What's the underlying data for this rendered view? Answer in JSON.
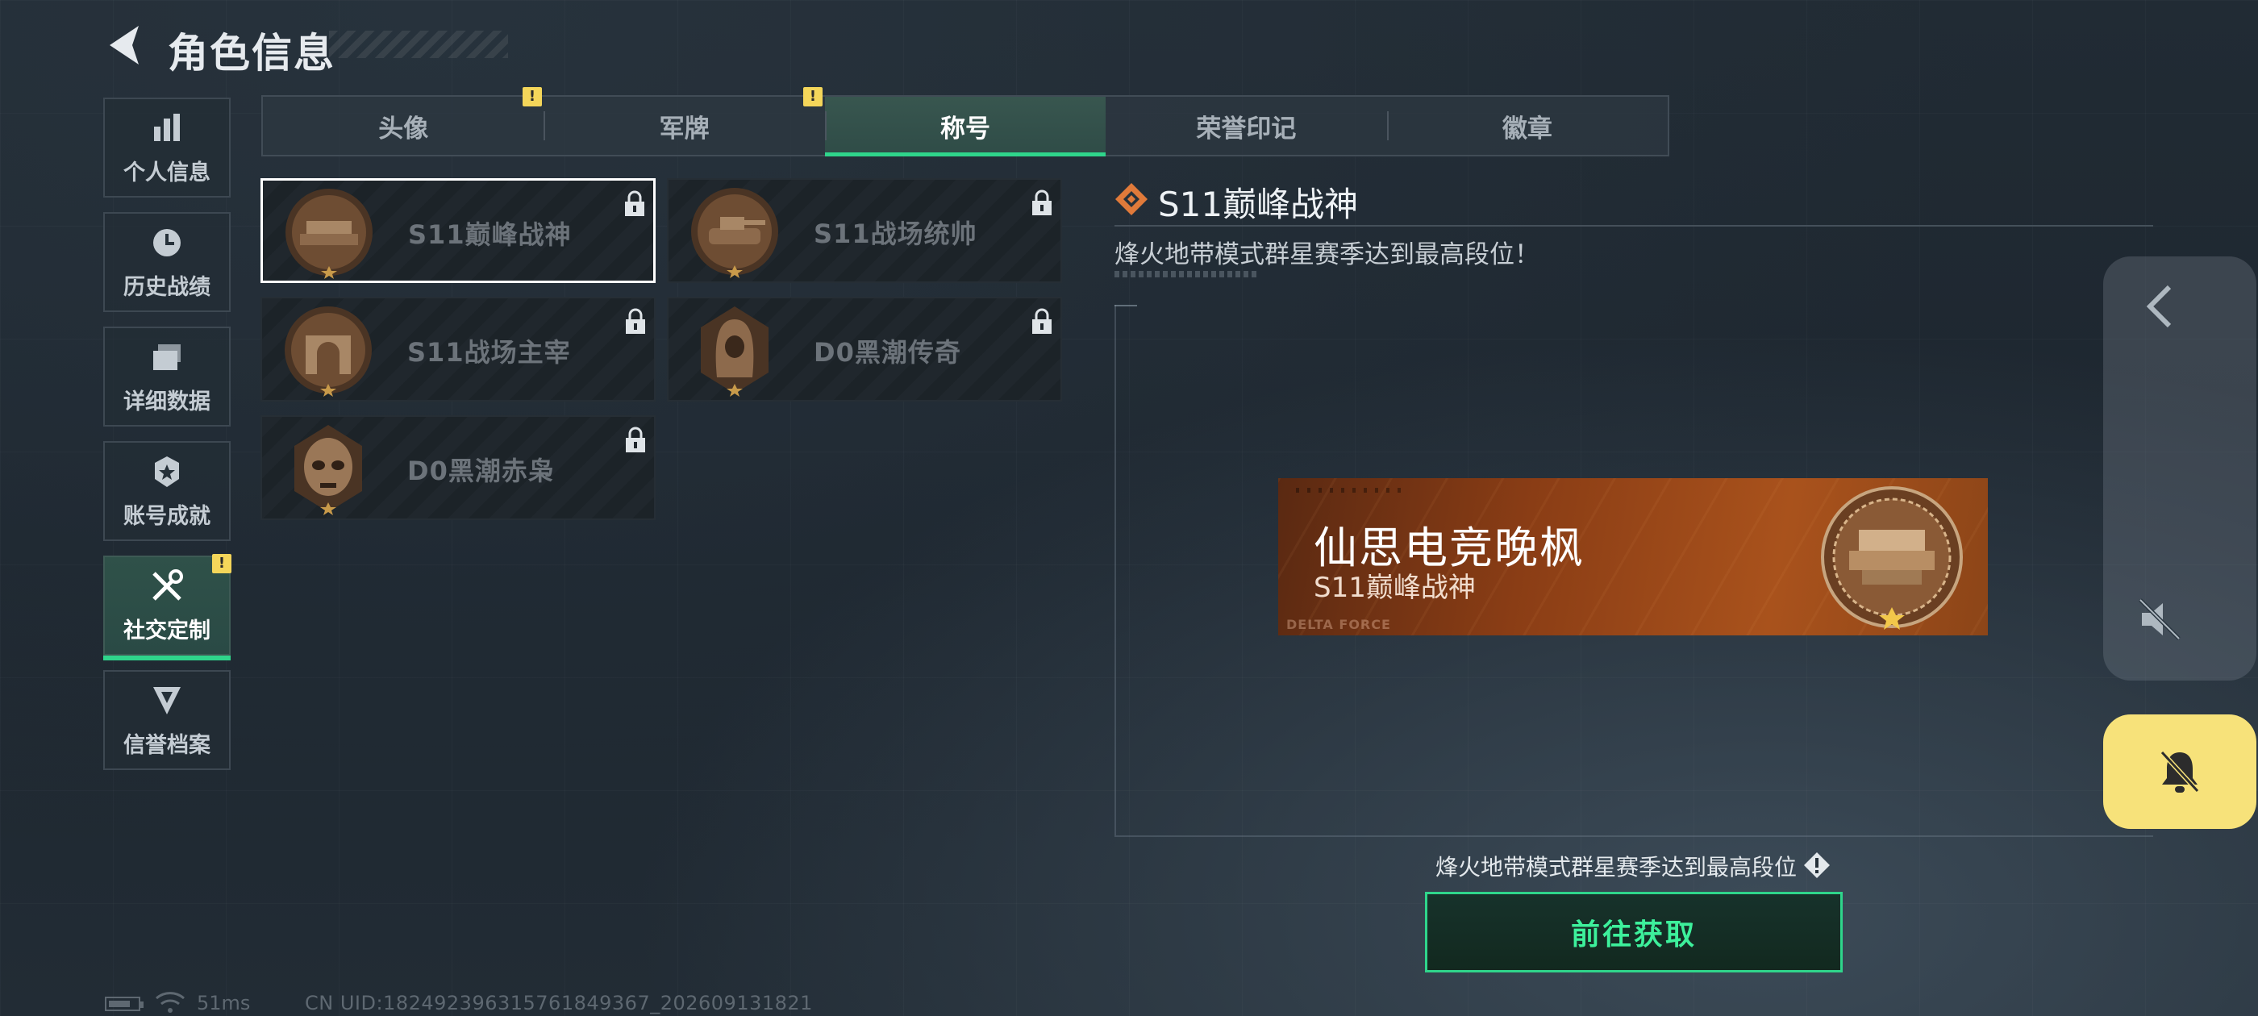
{
  "header": {
    "title": "角色信息",
    "back_icon": "back-arrow-icon"
  },
  "sidebar": {
    "items": [
      {
        "label": "个人信息",
        "icon": "bar-chart-icon"
      },
      {
        "label": "历史战绩",
        "icon": "clock-icon"
      },
      {
        "label": "详细数据",
        "icon": "folder-icon"
      },
      {
        "label": "账号成就",
        "icon": "star-emblem-icon"
      },
      {
        "label": "社交定制",
        "icon": "tools-icon",
        "active": true,
        "alert": "!"
      },
      {
        "label": "信誉档案",
        "icon": "credit-emblem-icon"
      }
    ]
  },
  "tabs": [
    {
      "label": "头像",
      "alert": "!"
    },
    {
      "label": "军牌",
      "alert": "!"
    },
    {
      "label": "称号",
      "active": true
    },
    {
      "label": "荣誉印记"
    },
    {
      "label": "徽章"
    }
  ],
  "titles": [
    {
      "name": "S11巅峰战神",
      "medal": "hovercraft-medal",
      "locked": true,
      "selected": true
    },
    {
      "name": "S11战场统帅",
      "medal": "tank-medal",
      "locked": true
    },
    {
      "name": "S11战场主宰",
      "medal": "arch-medal",
      "locked": true
    },
    {
      "name": "D0黑潮传奇",
      "medal": "hooded-figure-medal",
      "locked": true
    },
    {
      "name": "D0黑潮赤枭",
      "medal": "skull-mask-medal",
      "locked": true
    }
  ],
  "detail": {
    "title": "S11巅峰战神",
    "description": "烽火地带模式群星赛季达到最高段位！",
    "preview": {
      "player_name": "仙思电竞晚枫",
      "title": "S11巅峰战神",
      "brand": "DELTA FORCE"
    },
    "requirement": "烽火地带模式群星赛季达到最高段位",
    "action_label": "前往获取"
  },
  "floating": {
    "chevron_icon": "chevron-left-icon",
    "mute_icon": "speaker-mute-icon",
    "bell_icon": "bell-off-icon"
  },
  "status": {
    "latency": "51ms",
    "uid": "CN UID:182492396315761849367_202609131821"
  },
  "colors": {
    "accent": "#2fd58b",
    "alert": "#f4d65a",
    "banner": "#a9521c",
    "bell": "#f7e27a"
  }
}
